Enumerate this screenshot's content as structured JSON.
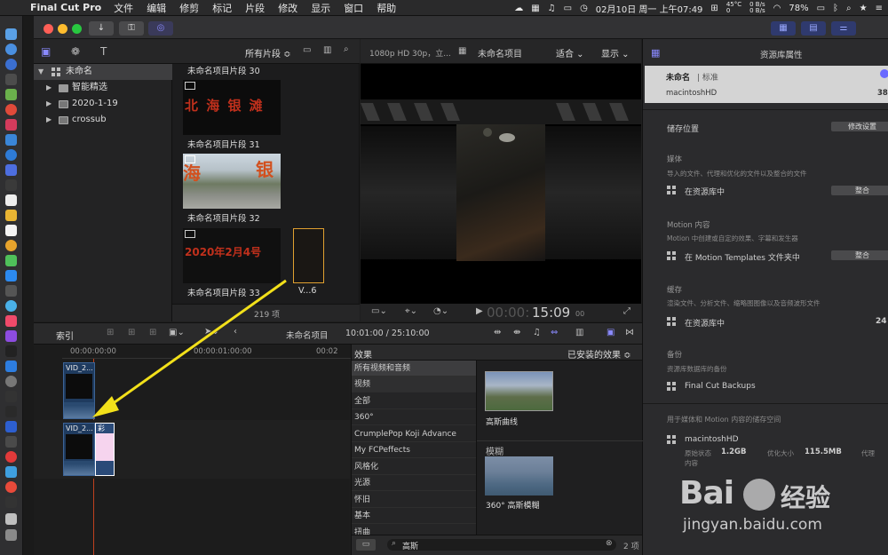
{
  "menubar": {
    "app_name": "Final Cut Pro",
    "menus": [
      "文件",
      "编辑",
      "修剪",
      "标记",
      "片段",
      "修改",
      "显示",
      "窗口",
      "帮助"
    ],
    "temp_top": "45°C",
    "temp_bottom": "0",
    "fan_top": "0 B/s",
    "fan_bottom": "0 B/s",
    "datetime": "02月10日 周一 上午07:49",
    "battery": "78%"
  },
  "library": {
    "root": "未命名",
    "items": [
      "智能精选",
      "2020-1-19",
      "crossub"
    ]
  },
  "browser": {
    "filter": "所有片段 ≎",
    "clips": [
      "未命名项目片段 30",
      "未命名项目片段 31",
      "未命名项目片段 32",
      "未命名项目片段 33",
      "V...6"
    ],
    "thumb_texts": [
      "北 海 银 滩",
      "2020年2月4号"
    ],
    "count": "219 项"
  },
  "viewer": {
    "format": "1080p HD 30p，立...",
    "project": "未命名项目",
    "fit": "适合 ⌄",
    "display": "显示 ⌄",
    "timecode": "00:00:15:09",
    "timecode_dim": "00",
    "timecode_main": "15:09",
    "timecode_frames": "00"
  },
  "timeline": {
    "index_label": "索引",
    "project": "未命名项目",
    "position": "10:01:00 / 25:10:00",
    "ruler": [
      "00:00:00:00",
      "00:00:01:00:00",
      "00:02"
    ],
    "clips": [
      "VID_2...",
      "VID_2...",
      "彩"
    ]
  },
  "effects": {
    "header": "效果",
    "installed": "已安装的效果 ≎",
    "categories": [
      "所有视频和音频",
      "视频",
      "全部",
      "360°",
      "CrumplePop Koji Advance",
      "My FCPeffects",
      "风格化",
      "光源",
      "怀旧",
      "基本",
      "扭曲"
    ],
    "section_blur": "模糊",
    "effect_1": "高斯曲线",
    "effect_2": "360° 高斯模糊",
    "search": "高斯",
    "result_count": "2 项"
  },
  "inspector": {
    "title": "资源库属性",
    "library_name": "未命名",
    "library_tag": "标准",
    "disk": "macintoshHD",
    "disk_size": "38",
    "storage_label": "储存位置",
    "modify_btn": "修改设置",
    "media_title": "媒体",
    "media_desc": "导入的文件、代理和优化的文件以及整合的文件",
    "media_loc": "在资源库中",
    "consolidate_btn": "整合",
    "motion_title": "Motion 内容",
    "motion_desc": "Motion 中创建或自定的效果、字幕和发生器",
    "motion_loc": "在 Motion Templates 文件夹中",
    "consolidate_btn2": "整合",
    "cache_title": "缓存",
    "cache_desc": "渲染文件、分析文件、缩略图图像以及音频波形文件",
    "cache_loc": "在资源库中",
    "cache_size": "24",
    "backup_title": "备份",
    "backup_desc": "资源库数据库的备份",
    "backup_loc": "Final Cut Backups",
    "space_title": "用于媒体和 Motion 内容的储存空间",
    "space_disk": "macintoshHD",
    "orig_label": "原始状态",
    "orig_val": "1.2GB",
    "opt_label": "优化大小",
    "opt_val": "115.5MB",
    "proxy_label": "代理",
    "content_label": "内容"
  },
  "watermark": {
    "brand_left": "Bai",
    "brand_right": "经验",
    "url": "jingyan.baidu.com"
  }
}
